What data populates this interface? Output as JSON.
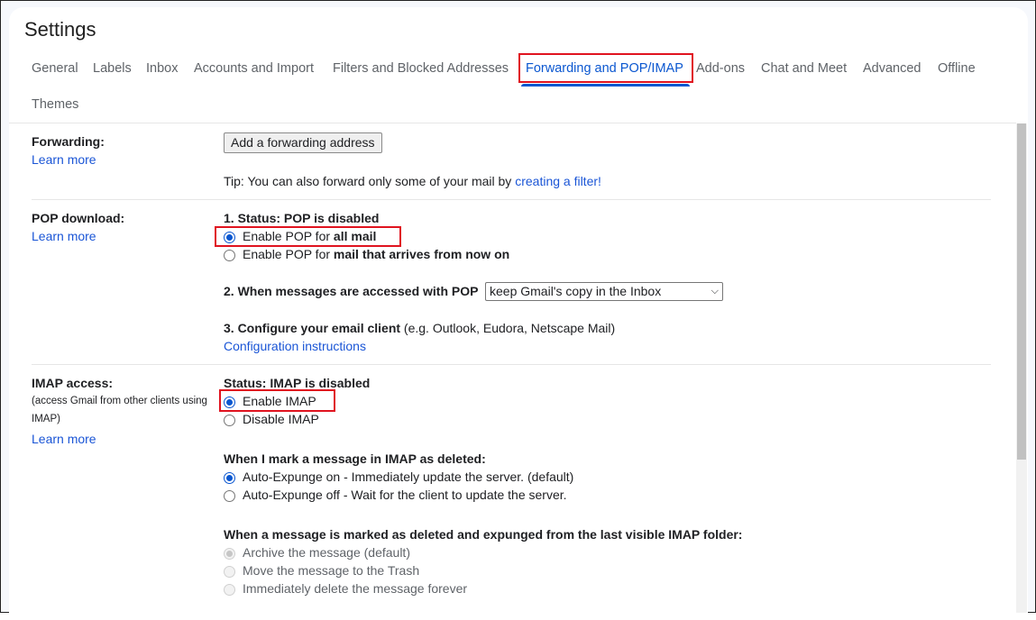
{
  "header": {
    "title": "Settings"
  },
  "tabs": [
    {
      "label": "General"
    },
    {
      "label": "Labels"
    },
    {
      "label": "Inbox"
    },
    {
      "label": "Accounts and Import"
    },
    {
      "label": "Filters and Blocked Addresses"
    },
    {
      "label": "Forwarding and POP/IMAP",
      "active": true
    },
    {
      "label": "Add-ons"
    },
    {
      "label": "Chat and Meet"
    },
    {
      "label": "Advanced"
    },
    {
      "label": "Offline"
    },
    {
      "label": "Themes"
    }
  ],
  "forwarding": {
    "label": "Forwarding:",
    "learn_more": "Learn more",
    "button": "Add a forwarding address",
    "tip_prefix": "Tip: You can also forward only some of your mail by ",
    "tip_link": "creating a filter!"
  },
  "pop": {
    "label": "POP download:",
    "learn_more": "Learn more",
    "status": "1. Status: POP is disabled",
    "opt1_prefix": "Enable POP for ",
    "opt1_bold": "all mail",
    "opt2_prefix": "Enable POP for ",
    "opt2_bold": "mail that arrives from now on",
    "access_label": "2. When messages are accessed with POP",
    "access_value": "keep Gmail's copy in the Inbox",
    "config_bold": "3. Configure your email client",
    "config_rest": " (e.g. Outlook, Eudora, Netscape Mail)",
    "config_link": "Configuration instructions"
  },
  "imap": {
    "label": "IMAP access:",
    "desc1": "(access Gmail from other clients using",
    "desc2": "IMAP)",
    "learn_more": "Learn more",
    "status": "Status: IMAP is disabled",
    "enable": "Enable IMAP",
    "disable": "Disable IMAP",
    "deleted_heading": "When I mark a message in IMAP as deleted:",
    "expunge_on": "Auto-Expunge on - Immediately update the server. (default)",
    "expunge_off": "Auto-Expunge off - Wait for the client to update the server.",
    "expunged_heading": "When a message is marked as deleted and expunged from the last visible IMAP folder:",
    "archive": "Archive the message (default)",
    "trash": "Move the message to the Trash",
    "delete": "Immediately delete the message forever"
  },
  "colors": {
    "accent": "#0b57d0",
    "highlight": "#e0131f",
    "link": "#1a55d6"
  }
}
